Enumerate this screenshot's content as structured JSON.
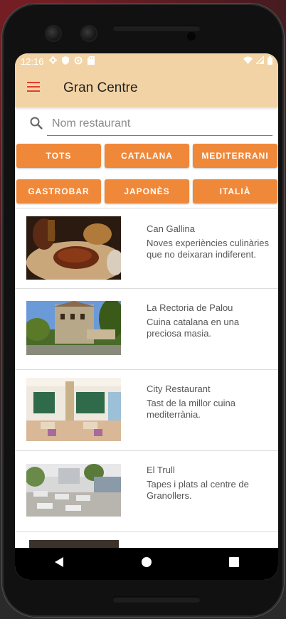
{
  "status_bar": {
    "time": "12:16",
    "left_icons": [
      "gear-icon",
      "shield-icon",
      "sync-icon",
      "sd-card-icon"
    ],
    "right_icons": [
      "wifi-icon",
      "signal-icon",
      "battery-icon"
    ]
  },
  "appbar": {
    "title": "Gran Centre",
    "menu_icon": "hamburger-menu-icon"
  },
  "search": {
    "placeholder": "Nom restaurant",
    "value": ""
  },
  "filters": {
    "row1": [
      "TOTS",
      "CATALANA",
      "MEDITERRANI"
    ],
    "row2": [
      "GASTROBAR",
      "JAPONÈS",
      "ITALIÀ"
    ]
  },
  "restaurants": [
    {
      "name": "Can Gallina",
      "description": "Noves experiències culinàries que no deixaran indiferent."
    },
    {
      "name": "La Rectoria de Palou",
      "description": "Cuina catalana en una preciosa masia."
    },
    {
      "name": "City Restaurant",
      "description": "Tast de la millor cuina mediterrània."
    },
    {
      "name": "El Trull",
      "description": "Tapes i plats al centre de Granollers."
    }
  ],
  "colors": {
    "appbar": "#f2d3a5",
    "chip": "#f0883a",
    "menu_icon": "#e0402a",
    "navbar": "#000000"
  },
  "navbar": [
    "back-icon",
    "home-icon",
    "recents-icon"
  ]
}
